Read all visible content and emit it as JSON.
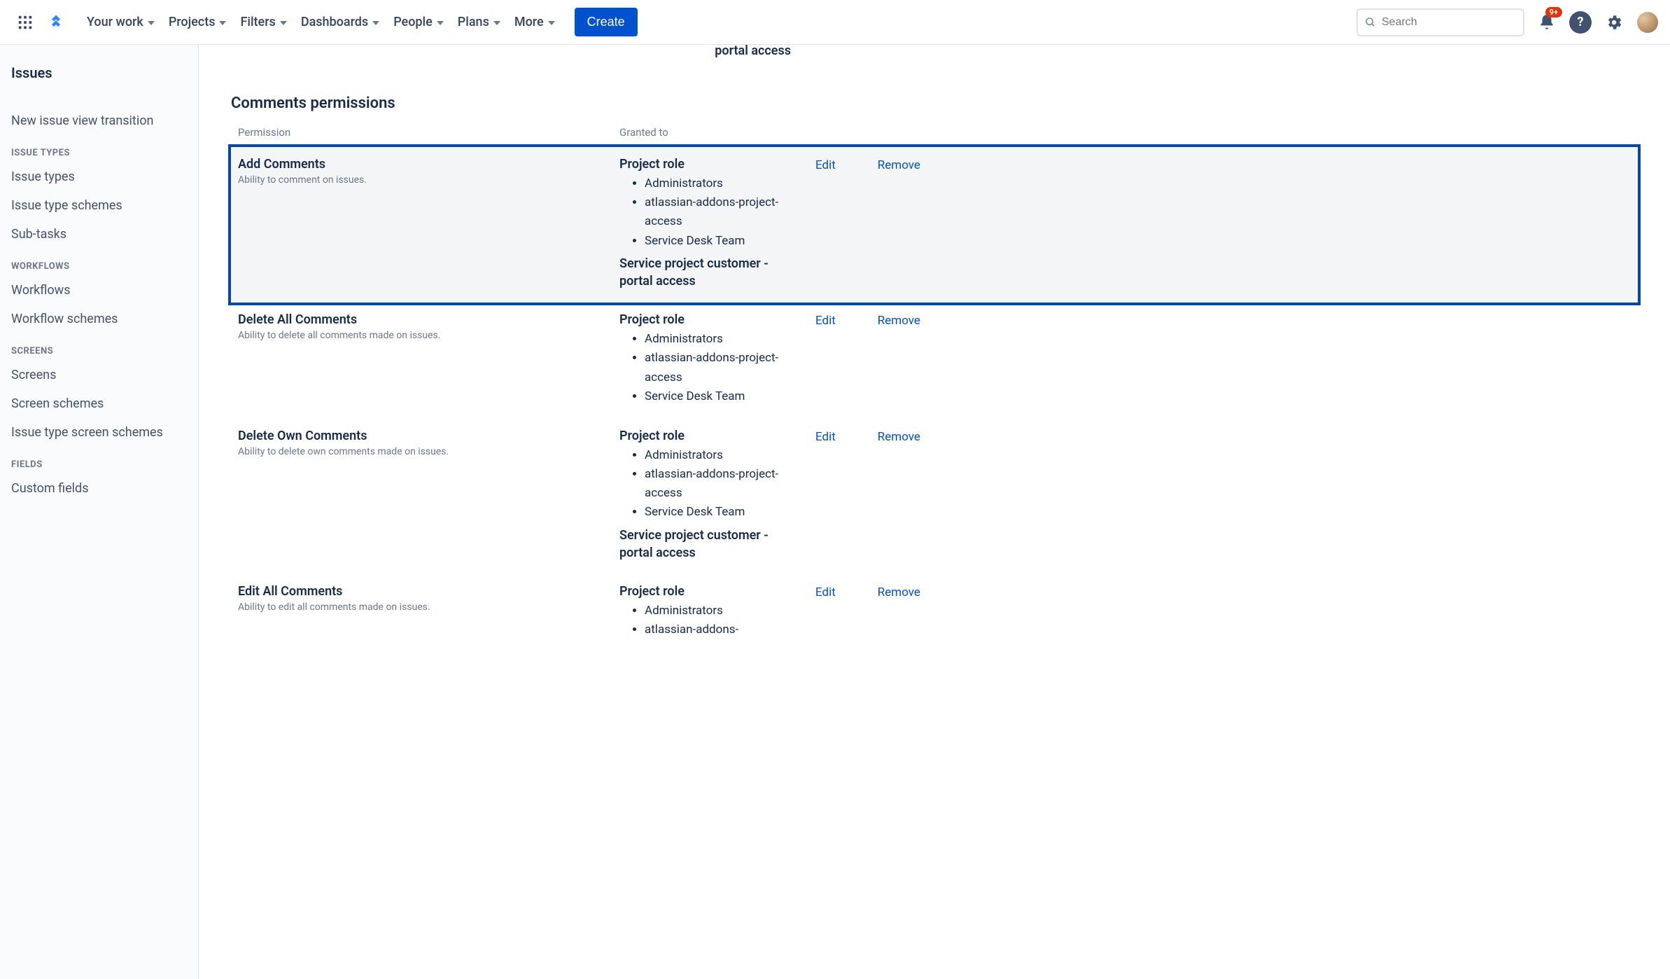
{
  "nav": {
    "menu": [
      "Your work",
      "Projects",
      "Filters",
      "Dashboards",
      "People",
      "Plans",
      "More"
    ],
    "create": "Create",
    "search_placeholder": "Search",
    "notif_badge": "9+"
  },
  "sidebar": {
    "heading": "Issues",
    "items": [
      {
        "kind": "spacer"
      },
      {
        "kind": "item",
        "label": "New issue view transition"
      },
      {
        "kind": "section",
        "label": "ISSUE TYPES"
      },
      {
        "kind": "item",
        "label": "Issue types"
      },
      {
        "kind": "item",
        "label": "Issue type schemes"
      },
      {
        "kind": "item",
        "label": "Sub-tasks"
      },
      {
        "kind": "section",
        "label": "WORKFLOWS"
      },
      {
        "kind": "item",
        "label": "Workflows"
      },
      {
        "kind": "item",
        "label": "Workflow schemes"
      },
      {
        "kind": "section",
        "label": "SCREENS"
      },
      {
        "kind": "item",
        "label": "Screens"
      },
      {
        "kind": "item",
        "label": "Screen schemes"
      },
      {
        "kind": "item",
        "label": "Issue type screen schemes"
      },
      {
        "kind": "section",
        "label": "FIELDS"
      },
      {
        "kind": "item",
        "label": "Custom fields"
      }
    ]
  },
  "main": {
    "cut_text": "portal access",
    "section_title": "Comments permissions",
    "col_perm": "Permission",
    "col_grant": "Granted to",
    "grant_header": "Project role",
    "extra_grant": "Service project customer - portal access",
    "edit": "Edit",
    "remove": "Remove",
    "roles": [
      "Administrators",
      "atlassian-addons-project-access",
      "Service Desk Team"
    ],
    "rows": [
      {
        "name": "Add Comments",
        "desc": "Ability to comment on issues.",
        "extra": true,
        "hl": true
      },
      {
        "name": "Delete All Comments",
        "desc": "Ability to delete all comments made on issues.",
        "extra": false,
        "hl": false
      },
      {
        "name": "Delete Own Comments",
        "desc": "Ability to delete own comments made on issues.",
        "extra": true,
        "hl": false
      },
      {
        "name": "Edit All Comments",
        "desc": "Ability to edit all comments made on issues.",
        "extra": false,
        "hl": false,
        "partial": true
      }
    ]
  }
}
